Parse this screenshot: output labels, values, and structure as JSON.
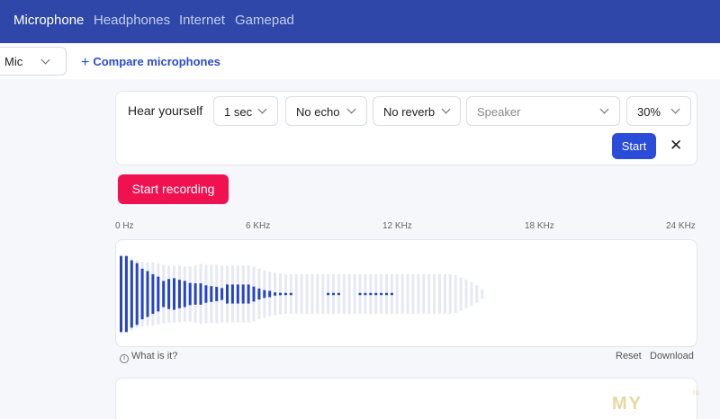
{
  "nav": {
    "tabs": [
      {
        "label": "Microphone",
        "active": true
      },
      {
        "label": "Headphones",
        "active": false
      },
      {
        "label": "Internet",
        "active": false
      },
      {
        "label": "Gamepad",
        "active": false
      }
    ]
  },
  "subbar": {
    "mic_select": "Mic",
    "compare_label": "Compare microphones"
  },
  "hear": {
    "label": "Hear yourself",
    "delay": "1 sec",
    "echo": "No echo",
    "reverb": "No reverb",
    "output_placeholder": "Speaker",
    "volume": "30%",
    "start_label": "Start",
    "close_symbol": "✕"
  },
  "recording": {
    "button_label": "Start recording"
  },
  "spectrum": {
    "freq_labels": [
      "0 Hz",
      "6 KHz",
      "12 KHz",
      "18 KHz",
      "24 KHz"
    ],
    "active_levels": [
      0.96,
      0.96,
      0.85,
      0.78,
      0.64,
      0.58,
      0.5,
      0.44,
      0.33,
      0.38,
      0.4,
      0.36,
      0.33,
      0.28,
      0.27,
      0.27,
      0.22,
      0.2,
      0.18,
      0.15,
      0.24,
      0.24,
      0.24,
      0.24,
      0.24,
      0.19,
      0.14,
      0.1,
      0.08,
      0.04,
      0.03,
      0.02,
      0.02,
      0.0,
      0.0,
      0.0,
      0.0,
      0.0,
      0.0,
      0.02,
      0.02,
      0.02,
      0.0,
      0.0,
      0.0,
      0.02,
      0.02,
      0.02,
      0.02,
      0.02,
      0.02,
      0.02,
      0.0,
      0.0,
      0.0,
      0.0,
      0.0,
      0.0,
      0.0,
      0.0,
      0.0,
      0.0,
      0.0,
      0.0,
      0.0,
      0.0,
      0.0,
      0.0,
      0.0
    ],
    "peak_levels": [
      1.0,
      0.98,
      0.92,
      0.86,
      0.82,
      0.8,
      0.8,
      0.77,
      0.74,
      0.72,
      0.72,
      0.72,
      0.7,
      0.7,
      0.72,
      0.76,
      0.74,
      0.74,
      0.74,
      0.72,
      0.72,
      0.72,
      0.72,
      0.72,
      0.72,
      0.7,
      0.64,
      0.6,
      0.56,
      0.54,
      0.52,
      0.5,
      0.5,
      0.5,
      0.5,
      0.5,
      0.5,
      0.5,
      0.5,
      0.5,
      0.5,
      0.5,
      0.5,
      0.5,
      0.5,
      0.5,
      0.5,
      0.5,
      0.5,
      0.5,
      0.5,
      0.5,
      0.5,
      0.5,
      0.5,
      0.5,
      0.5,
      0.5,
      0.5,
      0.5,
      0.5,
      0.5,
      0.5,
      0.48,
      0.42,
      0.36,
      0.3,
      0.22,
      0.12
    ],
    "active_color": "#2544c8",
    "peak_color": "#e6e9f4",
    "what_is_it": "What is it?",
    "reset_label": "Reset",
    "download_label": "Download"
  },
  "watermark": {
    "text": "MY",
    "small": "ru"
  }
}
